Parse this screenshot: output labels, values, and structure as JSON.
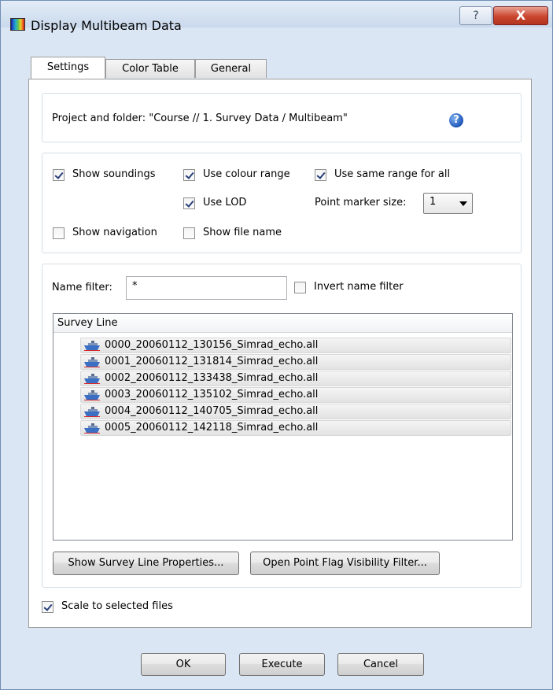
{
  "window": {
    "title": "Display Multibeam Data",
    "help_glyph": "?",
    "close_glyph": "X"
  },
  "tabs": [
    {
      "label": "Settings",
      "active": true
    },
    {
      "label": "Color Table",
      "active": false
    },
    {
      "label": "General",
      "active": false
    }
  ],
  "settings": {
    "project_folder": "Project and folder: \"Course // 1. Survey Data / Multibeam\"",
    "help_icon_glyph": "?",
    "options": {
      "show_soundings": {
        "label": "Show soundings",
        "checked": true
      },
      "use_colour_range": {
        "label": "Use colour range",
        "checked": true
      },
      "use_same_range": {
        "label": "Use same range for all",
        "checked": true
      },
      "use_lod": {
        "label": "Use LOD",
        "checked": true
      },
      "show_navigation": {
        "label": "Show navigation",
        "checked": false
      },
      "show_file_name": {
        "label": "Show file name",
        "checked": false
      }
    },
    "point_marker_size": {
      "label": "Point marker size:",
      "value": "1"
    },
    "name_filter": {
      "label": "Name filter:",
      "value": "*"
    },
    "invert_name_filter": {
      "label": "Invert name filter",
      "checked": false
    },
    "survey_list": {
      "header": "Survey Line",
      "items": [
        "0000_20060112_130156_Simrad_echo.all",
        "0001_20060112_131814_Simrad_echo.all",
        "0002_20060112_133438_Simrad_echo.all",
        "0003_20060112_135102_Simrad_echo.all",
        "0004_20060112_140705_Simrad_echo.all",
        "0005_20060112_142118_Simrad_echo.all"
      ]
    },
    "buttons": {
      "survey_line_properties": "Show Survey Line Properties...",
      "point_flag_filter": "Open Point Flag Visibility Filter..."
    },
    "scale_to_selected": {
      "label": "Scale to selected files",
      "checked": true
    }
  },
  "footer": {
    "ok": "OK",
    "execute": "Execute",
    "cancel": "Cancel"
  }
}
